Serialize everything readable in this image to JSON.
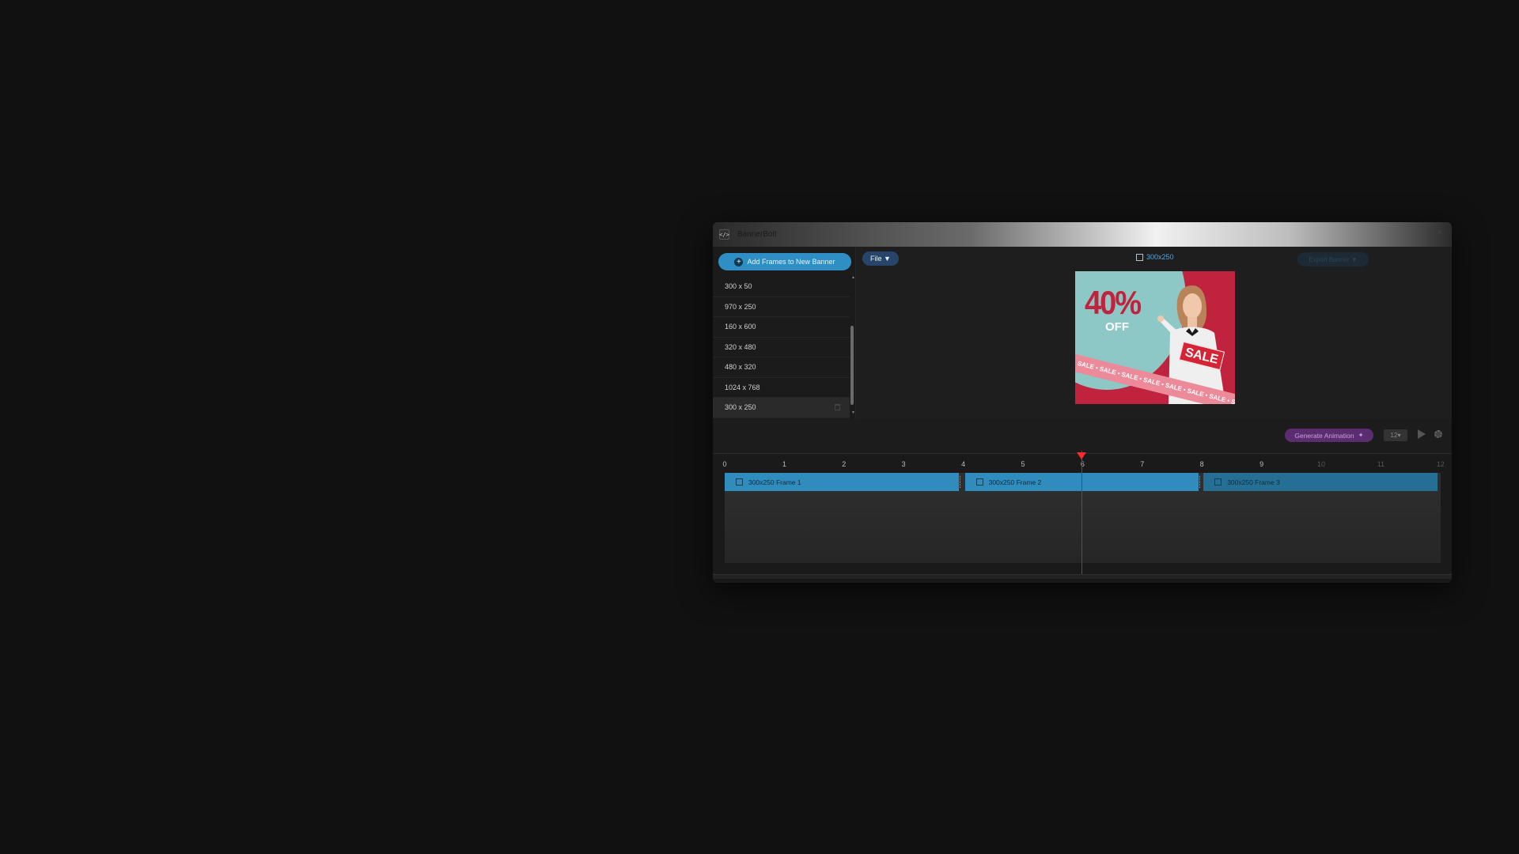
{
  "app": {
    "title": "BannerBolt"
  },
  "sidebar": {
    "add_button_label": "Add Frames to New Banner",
    "sizes": [
      "300 x 50",
      "970 x 250",
      "160 x 600",
      "320 x 480",
      "480 x 320",
      "1024 x 768",
      "300 x 250"
    ],
    "selected_index": 6
  },
  "toolbar": {
    "file_label": "File ▼",
    "canvas_size": "300x250",
    "export_label": "Export Banner ▼",
    "generate_label": "Generate Animation",
    "fps_value": "12"
  },
  "banner": {
    "headline": "40%",
    "subline": "OFF",
    "sign": "SALE",
    "ribbon": "SALE • SALE • SALE • SALE • SALE • SALE • SALE • SALE"
  },
  "timeline": {
    "ticks": [
      "0",
      "1",
      "2",
      "3",
      "4",
      "5",
      "6",
      "7",
      "8",
      "9",
      "10",
      "11",
      "12"
    ],
    "frames": [
      {
        "label": "300x250 Frame 1",
        "start": 0,
        "end": 4
      },
      {
        "label": "300x250 Frame 2",
        "start": 4,
        "end": 8
      },
      {
        "label": "300x250 Frame 3",
        "start": 8,
        "end": 12
      }
    ],
    "playhead": 6
  }
}
